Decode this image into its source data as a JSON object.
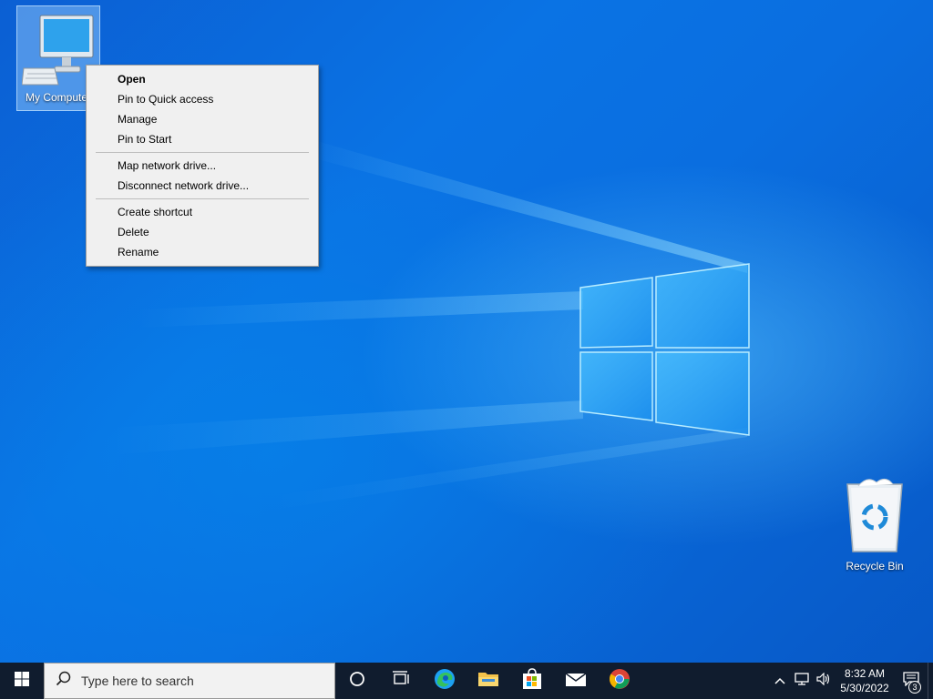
{
  "desktop": {
    "icons": [
      {
        "label": "My Computer"
      },
      {
        "label": "Recycle Bin"
      }
    ]
  },
  "context_menu": {
    "groups": [
      [
        "Open",
        "Pin to Quick access",
        "Manage",
        "Pin to Start"
      ],
      [
        "Map network drive...",
        "Disconnect network drive..."
      ],
      [
        "Create shortcut",
        "Delete",
        "Rename"
      ]
    ],
    "default_item": "Open"
  },
  "taskbar": {
    "search_placeholder": "Type here to search",
    "pinned_apps": [
      "Cortana",
      "Task View",
      "Microsoft Edge",
      "File Explorer",
      "Microsoft Store",
      "Mail",
      "Google Chrome"
    ],
    "clock": {
      "time": "8:32 AM",
      "date": "5/30/2022"
    },
    "notification_count": "3"
  },
  "colors": {
    "taskbar_bg": "#101c2e",
    "menu_bg": "#f0f0f0",
    "accent": "#0a6ee0"
  }
}
